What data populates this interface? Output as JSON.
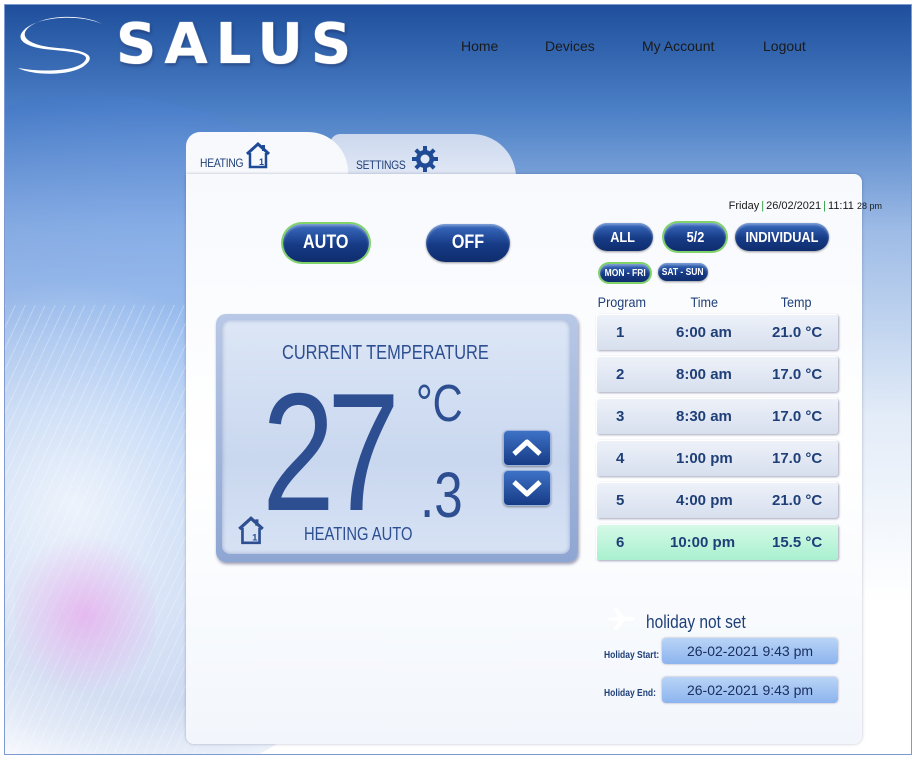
{
  "app": {
    "brand": "SALUS"
  },
  "nav": {
    "home": "Home",
    "devices": "Devices",
    "my_account": "My Account",
    "logout": "Logout"
  },
  "tabs": {
    "heating": "HEATING",
    "settings": "SETTINGS"
  },
  "datetime": {
    "day": "Friday",
    "date": "26/02/2021",
    "time": "11:11",
    "seconds": "28 pm"
  },
  "mode_buttons": {
    "auto": "AUTO",
    "off": "OFF",
    "active": "AUTO"
  },
  "schedule_buttons": {
    "all": "ALL",
    "five_two": "5/2",
    "individual": "INDIVIDUAL",
    "active": "5/2"
  },
  "day_buttons": {
    "mon_fri": "MON - FRI",
    "sat_sun": "SAT - SUN",
    "active": "MON - FRI"
  },
  "program_table": {
    "headers": {
      "program": "Program",
      "time": "Time",
      "temp": "Temp"
    },
    "rows": [
      {
        "program": "1",
        "time": "6:00 am",
        "temp": "21.0 °C"
      },
      {
        "program": "2",
        "time": "8:00 am",
        "temp": "17.0 °C"
      },
      {
        "program": "3",
        "time": "8:30 am",
        "temp": "17.0 °C"
      },
      {
        "program": "4",
        "time": "1:00 pm",
        "temp": "17.0 °C"
      },
      {
        "program": "5",
        "time": "4:00 pm",
        "temp": "21.0 °C"
      },
      {
        "program": "6",
        "time": "10:00 pm",
        "temp": "15.5 °C"
      }
    ],
    "highlighted_program": "6"
  },
  "temperature": {
    "label": "CURRENT TEMPERATURE",
    "integer": "27",
    "decimal": ".3",
    "unit": "°C",
    "status": "HEATING AUTO"
  },
  "holiday": {
    "status": "holiday not set",
    "start_label": "Holiday Start:",
    "start_value": "26-02-2021 9:43 pm",
    "end_label": "Holiday End:",
    "end_value": "26-02-2021 9:43 pm"
  },
  "colors": {
    "accent_dark": "#163a85",
    "text_blue": "#1f3f78",
    "active_outline": "#7fd36a",
    "highlight_row": "#a9f0cf"
  }
}
